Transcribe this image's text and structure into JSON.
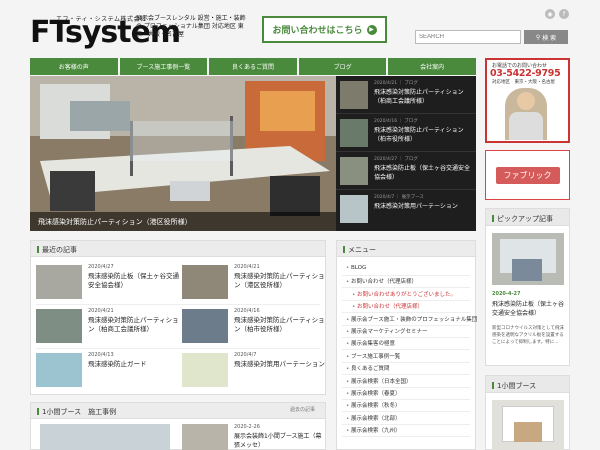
{
  "header": {
    "logo_kana": "エフ・ティ・システム株式会社",
    "logo_text": "FTsystem",
    "tagline": "展示会ブースレンタル 設営・施工・装飾の プロフェッショナル集団 対応地区 東京・大阪・名古屋",
    "contact_label": "お問い合わせはこちら",
    "search_placeholder": "SEARCH",
    "search_button": "検 索",
    "rss_icon": "rss-icon",
    "facebook_icon": "facebook-icon"
  },
  "nav": [
    "お客様の声",
    "ブース施工事例一覧",
    "良くあるご質問",
    "ブログ",
    "会社案内"
  ],
  "hero": {
    "caption": "飛沫感染対策防止パーティション（港区役所様）"
  },
  "feed": [
    {
      "meta": "2020/4/21 ｜ ブログ",
      "title": "飛沫感染対策防止パーティション（柏商工会議所様）"
    },
    {
      "meta": "2020/4/16 ｜ ブログ",
      "title": "飛沫感染対策防止パーティション（柏市役所様）"
    },
    {
      "meta": "2020/4/27 ｜ ブログ",
      "title": "飛沫感染防止板（保土ヶ谷交通安全協会様）"
    },
    {
      "meta": "2020/4/7 ｜ 展示ブース",
      "title": "飛沫感染対策用パーテーション"
    }
  ],
  "sidebar": {
    "phone_label": "お電話でのお問い合わせ",
    "phone": "03-5422-9795",
    "phone_sub": "対応地区　東京・大阪・名古屋",
    "fabric_label": "ファブリック",
    "pickup_head": "ピックアップ記事",
    "pickup_date": "2020-4-27",
    "pickup_title": "飛沫感染防止板（保土ヶ谷交通安全協会様）",
    "pickup_text": "新型コロナウイルス対策として飛沫感染を透明なアクリル板を設置することによって抑制します。特に...",
    "booth_head": "1小間ブース"
  },
  "recent": {
    "head": "最近の記事",
    "posts": [
      {
        "date": "2020/4/27",
        "title": "飛沫感染防止板（保土ヶ谷交通安全協会様）"
      },
      {
        "date": "2020/4/21",
        "title": "飛沫感染対策防止パーティション（港区役所様）"
      },
      {
        "date": "2020/4/21",
        "title": "飛沫感染対策防止パーティション（柏商工会議所様）"
      },
      {
        "date": "2020/4/16",
        "title": "飛沫感染対策防止パーティション（柏市役所様）"
      },
      {
        "date": "2020/4/13",
        "title": "飛沫感染防止ガード"
      },
      {
        "date": "2020/4/7",
        "title": "飛沫感染対策用パーテーション"
      }
    ]
  },
  "booth": {
    "head": "1小間ブース　施工事例",
    "more": "過去の記事",
    "date": "2020-2-26",
    "title": "展示会装飾1小間ブース施工（幕張メッセ）"
  },
  "menu": {
    "head": "メニュー",
    "items": [
      {
        "label": "BLOG",
        "sub": false
      },
      {
        "label": "お問い合わせ（代理店様）",
        "sub": false
      },
      {
        "label": "お問い合わせありがとうございました。",
        "sub": true
      },
      {
        "label": "お問い合わせ（代理店様）",
        "sub": true
      },
      {
        "label": "展示会ブース施工・装飾のプロフェッショナル集団",
        "sub": false
      },
      {
        "label": "展示会マーケティングセミナー",
        "sub": false
      },
      {
        "label": "展示会集客の極意",
        "sub": false
      },
      {
        "label": "ブース施工事例一覧",
        "sub": false
      },
      {
        "label": "良くあるご質問",
        "sub": false
      },
      {
        "label": "展示会検索（日本全国）",
        "sub": false
      },
      {
        "label": "展示会検索（春夏）",
        "sub": false
      },
      {
        "label": "展示会検索（秋冬）",
        "sub": false
      },
      {
        "label": "展示会検索（北部）",
        "sub": false
      },
      {
        "label": "展示会検索（九州）",
        "sub": false
      }
    ]
  },
  "colors": {
    "accent": "#4a8a3c",
    "phone": "#cc3333",
    "fabric": "#d55a5a"
  }
}
